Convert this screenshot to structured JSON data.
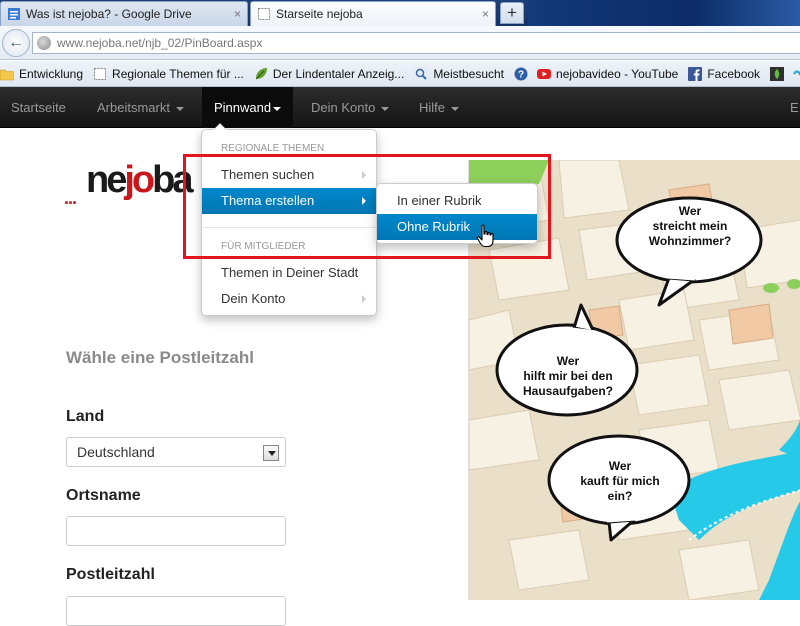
{
  "browser": {
    "tabs": [
      {
        "title": "Was ist nejoba? - Google Drive",
        "close": "×"
      },
      {
        "title": "Starseite nejoba",
        "close": "×"
      }
    ],
    "new_tab": "+",
    "url_host": "www.nejoba.net",
    "url_path": "/njb_02/PinBoard.aspx",
    "bookmarks": [
      {
        "label": "Entwicklung",
        "icon": "folder-icon"
      },
      {
        "label": "Regionale Themen für ...",
        "icon": "page-icon"
      },
      {
        "label": "Der Lindentaler Anzeig...",
        "icon": "leaf-icon"
      },
      {
        "label": "Meistbesucht",
        "icon": "search-icon"
      },
      {
        "label": "",
        "icon": "help-icon"
      },
      {
        "label": "nejobavideo - YouTube",
        "icon": "youtube-icon"
      },
      {
        "label": "Facebook",
        "icon": "facebook-icon"
      }
    ]
  },
  "site_nav": {
    "items": [
      "Startseite",
      "Arbeitsmarkt",
      "Pinnwand",
      "Dein Konto",
      "Hilfe"
    ],
    "right_partial": "E"
  },
  "dropdown": {
    "header1": "REGIONALE THEMEN",
    "item_themen_suchen": "Themen suchen",
    "item_thema_erstellen": "Thema erstellen",
    "header2": "FÜR MITGLIEDER",
    "item_themen_stadt": "Themen in Deiner Stadt",
    "item_dein_konto": "Dein Konto"
  },
  "submenu": {
    "item_in_rubrik": "In einer Rubrik",
    "item_ohne_rubrik": "Ohne Rubrik"
  },
  "logo": {
    "dots": "...",
    "ne": "ne",
    "jo": "jo",
    "ba": "ba"
  },
  "form": {
    "heading": "Wähle eine Postleitzahl",
    "land_label": "Land",
    "land_value": "Deutschland",
    "ort_label": "Ortsname",
    "plz_label": "Postleitzahl"
  },
  "map": {
    "bubble1": "Wer streicht mein Wohnzimmer?",
    "bubble2": "Wer hilft mir bei den Hausaufgaben?",
    "bubble3": "Wer kauft für mich ein?"
  },
  "colors": {
    "accent_blue": "#0088cc",
    "highlight_red": "#e1151b",
    "brand_red": "#c8171d",
    "navbar_dark": "#1b1b1b"
  }
}
